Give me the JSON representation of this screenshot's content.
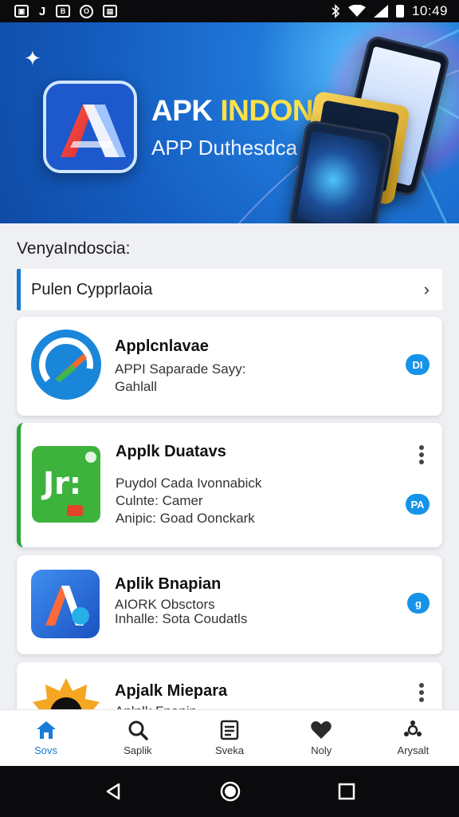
{
  "status_bar": {
    "left_icons": [
      "image-icon",
      "j-icon",
      "b-icon",
      "o-icon",
      "app-icon"
    ],
    "left_glyphs": [
      "▣",
      "J",
      "B",
      "O",
      "▤"
    ],
    "time": "10:49"
  },
  "hero": {
    "title_part1": "APK ",
    "title_part2": "INDONESIA",
    "subtitle": "APP Duthesdca",
    "accent_color": "#ffe14a"
  },
  "section": {
    "heading": "VenyaIndoscia:",
    "category_label": "Pulen Cypprlaoia"
  },
  "apps": [
    {
      "title": "Applcnlavae",
      "lines": [
        "APPI Saparade Sayy:",
        "Gahlall"
      ],
      "badge": "DI"
    },
    {
      "title": "Applk Duatavs",
      "lines": [
        "Puydol Cada Ivonnabick",
        "Culnte: Camer",
        "Anipic: Goad Oonckark"
      ],
      "badge": "PA",
      "icon_text": "Jr:"
    },
    {
      "title": "Aplik Bnapian",
      "lines": [
        "AIORK Obsctors",
        "Inhalle: Sota Coudatls"
      ],
      "badge": "g"
    },
    {
      "title": "Apjalk Miepara",
      "lines": [
        "Aplnlk Fnanin"
      ]
    }
  ],
  "bottom_nav": [
    {
      "label": "Sovs",
      "icon": "home-icon",
      "active": true
    },
    {
      "label": "Saplik",
      "icon": "search-icon"
    },
    {
      "label": "Sveka",
      "icon": "document-icon"
    },
    {
      "label": "Noly",
      "icon": "heart-icon"
    },
    {
      "label": "Arysalt",
      "icon": "settings-icon"
    }
  ],
  "system_nav": [
    "back-icon",
    "home-button-icon",
    "recents-icon"
  ],
  "colors": {
    "primary": "#1b7cd6",
    "green_accent": "#2aa53a",
    "badge": "#1693e8"
  }
}
